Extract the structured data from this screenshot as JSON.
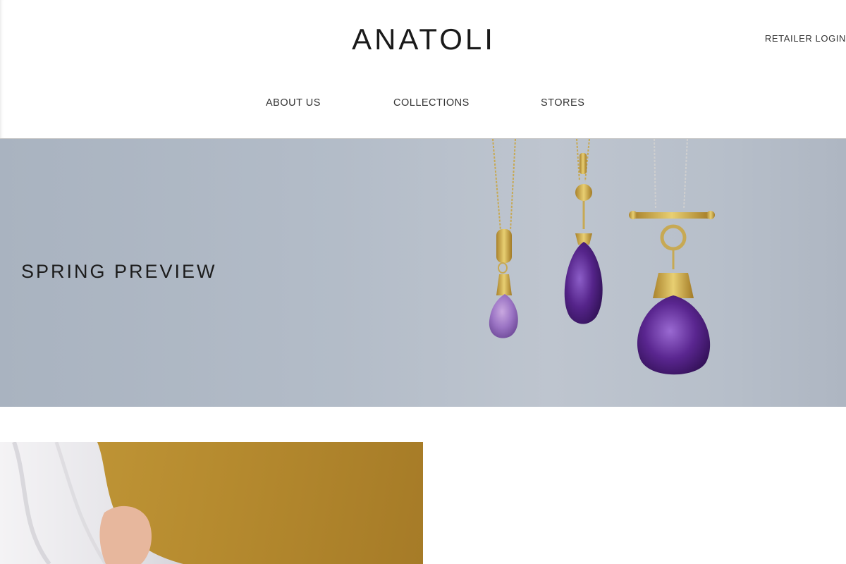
{
  "header": {
    "brand": "ANATOLI",
    "retailer_login": "RETAILER LOGIN",
    "nav": [
      {
        "label": "ABOUT US"
      },
      {
        "label": "COLLECTIONS"
      },
      {
        "label": "STORES"
      }
    ]
  },
  "hero": {
    "title": "SPRING PREVIEW"
  },
  "colors": {
    "hero_bg": "#b3bcc8",
    "gem_purple": "#5e2f8a",
    "gold": "#c9a646",
    "promo_bg": "#b68b2f"
  }
}
